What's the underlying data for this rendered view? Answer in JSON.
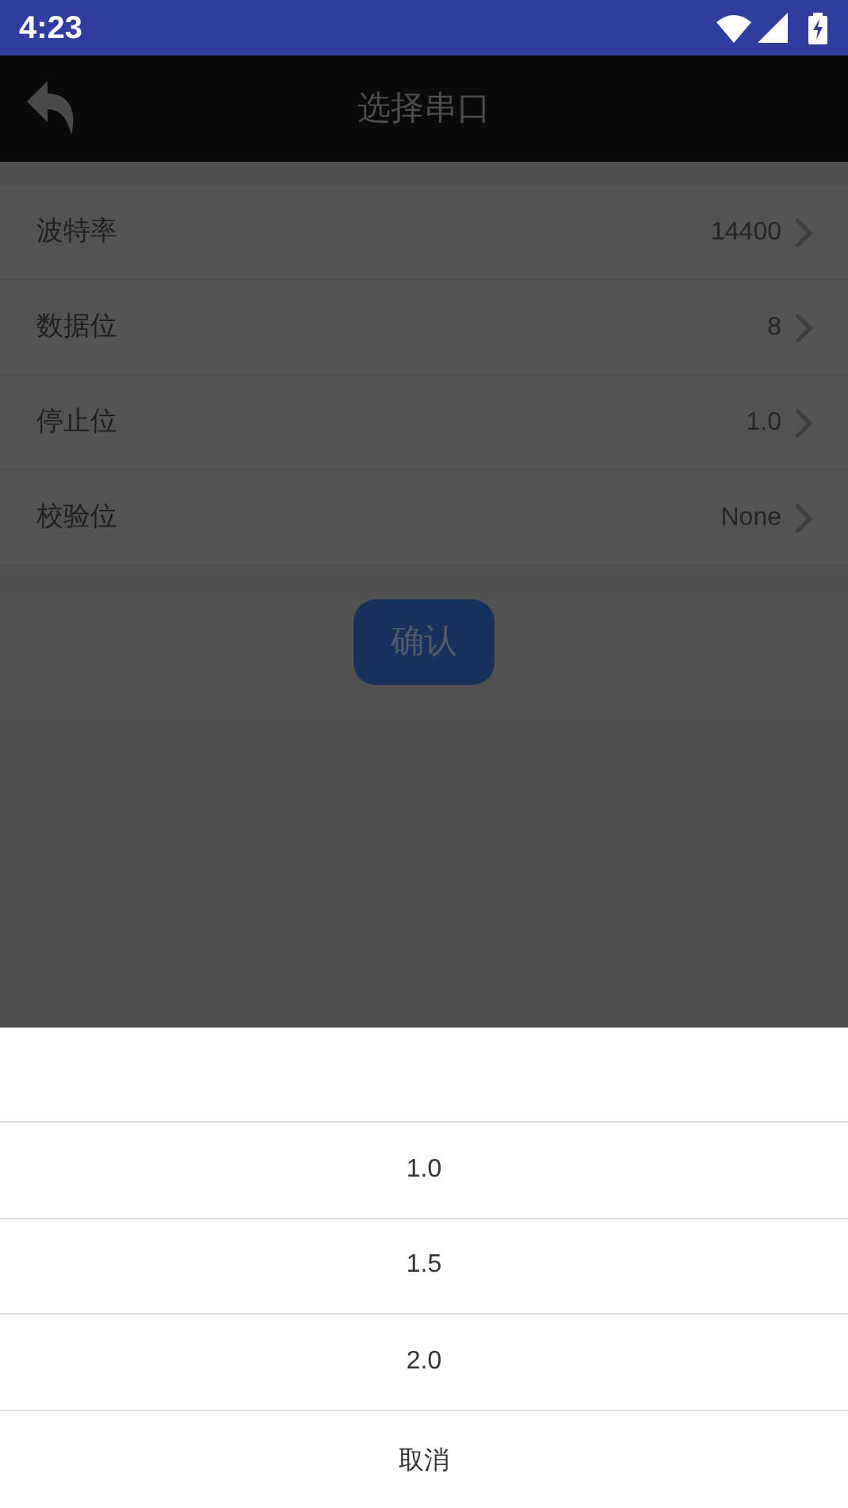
{
  "status_bar": {
    "time": "4:23"
  },
  "toolbar": {
    "title": "选择串口"
  },
  "settings": [
    {
      "label": "波特率",
      "value": "14400"
    },
    {
      "label": "数据位",
      "value": "8"
    },
    {
      "label": "停止位",
      "value": "1.0"
    },
    {
      "label": "校验位",
      "value": "None"
    }
  ],
  "confirm_button": "确认",
  "sheet": {
    "options": [
      "1.0",
      "1.5",
      "2.0"
    ],
    "cancel": "取消"
  }
}
